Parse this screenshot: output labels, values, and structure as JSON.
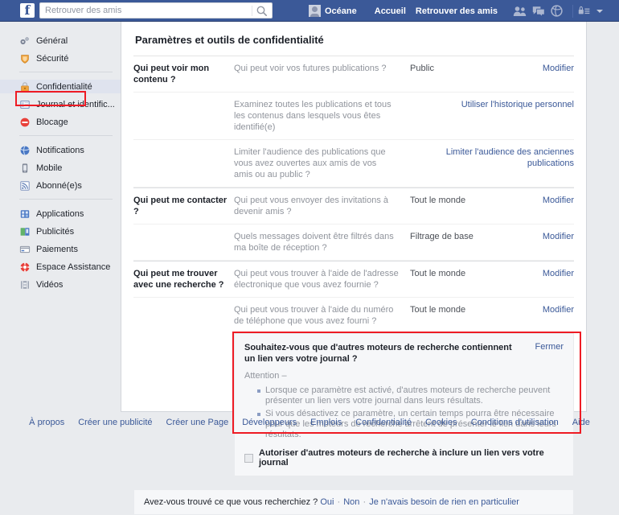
{
  "header": {
    "logo": "f",
    "search": {
      "placeholder": "Retrouver des amis",
      "value": "",
      "icon": "search-icon"
    },
    "user_name": "Océane",
    "links": [
      {
        "label": "Accueil",
        "name": "home-link"
      },
      {
        "label": "Retrouver des amis",
        "name": "find-friends-link"
      }
    ],
    "icons": [
      {
        "name": "friend-requests-icon"
      },
      {
        "name": "messages-icon"
      },
      {
        "name": "notifications-globe-icon"
      },
      {
        "name": "privacy-lock-icon"
      },
      {
        "name": "chevron-down-icon"
      }
    ],
    "brand_color": "#3b5998"
  },
  "sidebar": {
    "groups": [
      {
        "items": [
          {
            "label": "Général",
            "icon": "gears-icon",
            "active": false
          },
          {
            "label": "Sécurité",
            "icon": "shield-icon",
            "active": false
          }
        ]
      },
      {
        "items": [
          {
            "label": "Confidentialité",
            "icon": "padlock-icon",
            "active": true
          },
          {
            "label": "Journal et identific...",
            "icon": "timeline-icon",
            "active": false
          },
          {
            "label": "Blocage",
            "icon": "block-icon",
            "active": false
          }
        ]
      },
      {
        "items": [
          {
            "label": "Notifications",
            "icon": "globe-icon",
            "active": false
          },
          {
            "label": "Mobile",
            "icon": "mobile-icon",
            "active": false
          },
          {
            "label": "Abonné(e)s",
            "icon": "rss-icon",
            "active": false
          }
        ]
      },
      {
        "items": [
          {
            "label": "Applications",
            "icon": "apps-icon",
            "active": false
          },
          {
            "label": "Publicités",
            "icon": "ads-icon",
            "active": false
          },
          {
            "label": "Paiements",
            "icon": "payments-icon",
            "active": false
          },
          {
            "label": "Espace Assistance",
            "icon": "lifebuoy-icon",
            "active": false
          },
          {
            "label": "Vidéos",
            "icon": "video-icon",
            "active": false
          }
        ]
      }
    ],
    "highlight_color": "#ee1b24"
  },
  "main": {
    "page_title": "Paramètres et outils de confidentialité",
    "sections": [
      {
        "label": "Qui peut voir mon contenu ?",
        "rows": [
          {
            "question": "Qui peut voir vos futures publications ?",
            "value": "Public",
            "action": "Modifier",
            "action_wide": false
          },
          {
            "question": "Examinez toutes les publications et tous les contenus dans lesquels vous êtes identifié(e)",
            "value": "",
            "action": "Utiliser l'historique personnel",
            "action_wide": true
          },
          {
            "question": "Limiter l'audience des publications que vous avez ouvertes aux amis de vos amis ou au public ?",
            "value": "",
            "action": "Limiter l'audience des anciennes publications",
            "action_wide": true
          }
        ]
      },
      {
        "label": "Qui peut me contacter ?",
        "rows": [
          {
            "question": "Qui peut vous envoyer des invitations à devenir amis ?",
            "value": "Tout le monde",
            "action": "Modifier",
            "action_wide": false
          },
          {
            "question": "Quels messages doivent être filtrés dans ma boîte de réception ?",
            "value": "Filtrage de base",
            "action": "Modifier",
            "action_wide": false
          }
        ]
      },
      {
        "label": "Qui peut me trouver avec une recherche ?",
        "rows": [
          {
            "question": "Qui peut vous trouver à l'aide de l'adresse électronique que vous avez fournie ?",
            "value": "Tout le monde",
            "action": "Modifier",
            "action_wide": false
          },
          {
            "question": "Qui peut vous trouver à l'aide du numéro de téléphone que vous avez fourni ?",
            "value": "Tout le monde",
            "action": "Modifier",
            "action_wide": false
          }
        ]
      }
    ],
    "expanded_panel": {
      "title": "Souhaitez-vous que d'autres moteurs de recherche contiennent un lien vers votre journal ?",
      "close_label": "Fermer",
      "attention_label": "Attention –",
      "bullets": [
        "Lorsque ce paramètre est activé, d'autres moteurs de recherche peuvent présenter un lien vers votre journal dans leurs résultats.",
        "Si vous désactivez ce paramètre, un certain temps pourra être nécessaire pour que les moteurs de recherche arrêtent de présenter le lien dans leurs résultats."
      ],
      "checkbox_label": "Autoriser d'autres moteurs de recherche à inclure un lien vers votre journal",
      "checkbox_checked": false,
      "highlight_color": "#ee1b24"
    },
    "feedback": {
      "question": "Avez-vous trouvé ce que vous recherchiez ?",
      "options": [
        "Oui",
        "Non",
        "Je n'avais besoin de rien en particulier"
      ]
    }
  },
  "footer": {
    "links": [
      "À propos",
      "Créer une publicité",
      "Créer une Page",
      "Développeurs",
      "Emplois",
      "Confidentialité",
      "Cookies",
      "Conditions d'utilisation",
      "Aide"
    ]
  }
}
